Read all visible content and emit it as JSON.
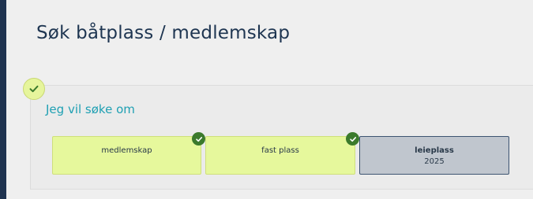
{
  "page": {
    "title": "Søk båtplass / medlemskap"
  },
  "section": {
    "label": "Jeg vil søke om",
    "step_icon": "check-icon",
    "options": [
      {
        "label": "medlemskap",
        "sublabel": "",
        "selected": true
      },
      {
        "label": "fast plass",
        "sublabel": "",
        "selected": true
      },
      {
        "label": "leieplass",
        "sublabel": "2025",
        "selected": false
      }
    ]
  },
  "colors": {
    "title": "#1e3551",
    "section_label": "#1fa0b3",
    "selected_fill": "#e6f89c",
    "unselected_fill": "#c0c6ce",
    "unselected_border": "#3d5471",
    "check_badge": "#3b7a2c",
    "side_stripe": "#1f3350"
  }
}
